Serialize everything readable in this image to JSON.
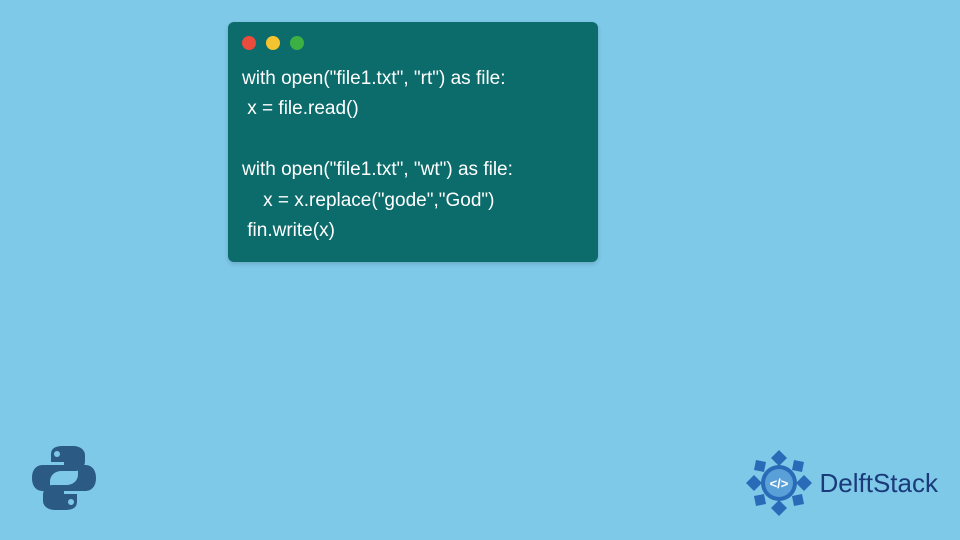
{
  "code": {
    "lines": [
      "with open(\"file1.txt\", \"rt\") as file:",
      " x = file.read()",
      " ",
      "with open(\"file1.txt\", \"wt\") as file:",
      "    x = x.replace(\"gode\",\"God\")",
      " fin.write(x)"
    ]
  },
  "brand": {
    "name": "DelftStack"
  },
  "icons": {
    "python": "python-logo",
    "brand_badge": "delftstack-badge"
  },
  "colors": {
    "background": "#7ec8e8",
    "window": "#0c6b6b",
    "brand_text": "#1a3a7a"
  }
}
